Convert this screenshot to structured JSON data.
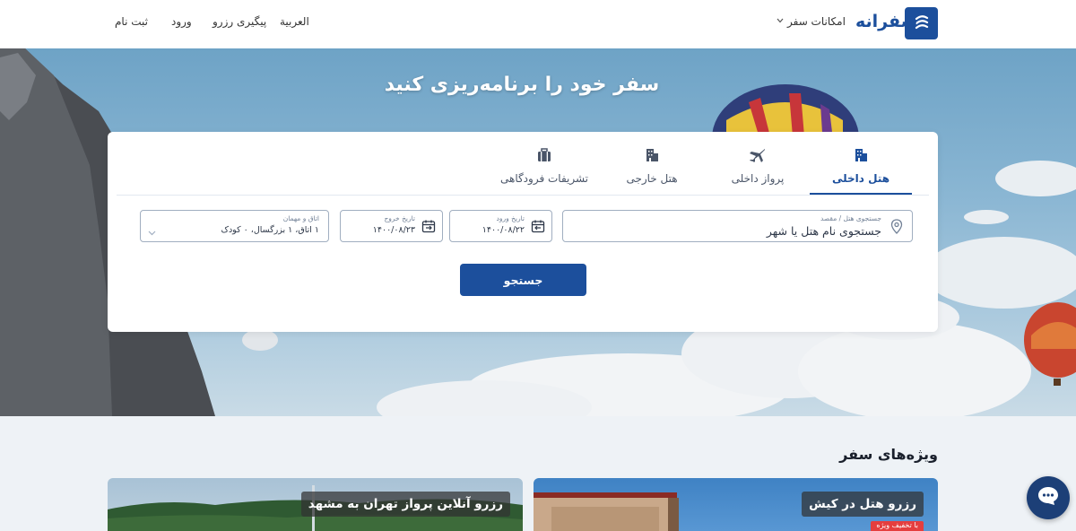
{
  "header": {
    "logo_text": "سفرانه",
    "travel_features": "امکانات سفر",
    "arabic": "العربية",
    "track_booking": "پیگیری رزرو",
    "login": "ورود",
    "signup": "ثبت نام"
  },
  "hero": {
    "title": "سفر خود را برنامه‌ریزی کنید"
  },
  "tabs": [
    {
      "label": "هتل داخلی",
      "icon": "building-icon",
      "active": true
    },
    {
      "label": "پرواز داخلی",
      "icon": "airplane-icon",
      "active": false
    },
    {
      "label": "هتل خارجی",
      "icon": "building-icon",
      "active": false
    },
    {
      "label": "تشریفات فرودگاهی",
      "icon": "suitcase-icon",
      "active": false
    }
  ],
  "search": {
    "destination_label": "جستجوی هتل / مقصد",
    "destination_placeholder": "جستجوی نام هتل یا شهر",
    "checkin_label": "تاریخ ورود",
    "checkin_value": "۱۴۰۰/۰۸/۲۲",
    "checkout_label": "تاریخ خروج",
    "checkout_value": "۱۴۰۰/۰۸/۲۳",
    "guests_label": "اتاق و مهمان",
    "guests_value": "۱ اتاق، ۱ بزرگسال، ۰ کودک",
    "button": "جستجو"
  },
  "specials": {
    "title": "ویژه‌های سفر",
    "cards": [
      {
        "label": "رزرو هتل در کیش",
        "badge": "با تخفیف ویژه"
      },
      {
        "label": "رزرو آنلاین پرواز تهران به مشهد"
      }
    ]
  },
  "colors": {
    "brand": "#1c4f9c",
    "chat": "#1c3f77",
    "badge": "#e53e3e"
  }
}
